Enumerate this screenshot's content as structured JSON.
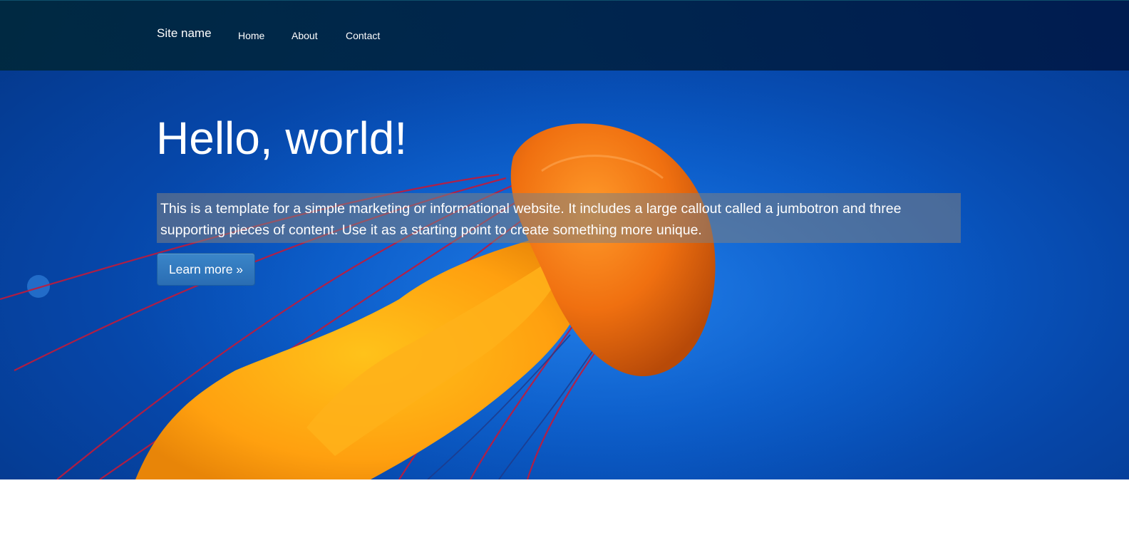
{
  "navbar": {
    "brand": "Site name",
    "links": [
      {
        "label": "Home"
      },
      {
        "label": "About"
      },
      {
        "label": "Contact"
      }
    ]
  },
  "jumbotron": {
    "heading": "Hello, world!",
    "lead": "This is a template for a simple marketing or informational website. It includes a large callout called a jumbotron and three supporting pieces of content. Use it as a starting point to create something more unique.",
    "button_label": "Learn more »"
  },
  "colors": {
    "ocean": "#0a5bc8",
    "navbar": "#002846",
    "button": "#337ab7",
    "jellyfish": "#f07a10"
  }
}
